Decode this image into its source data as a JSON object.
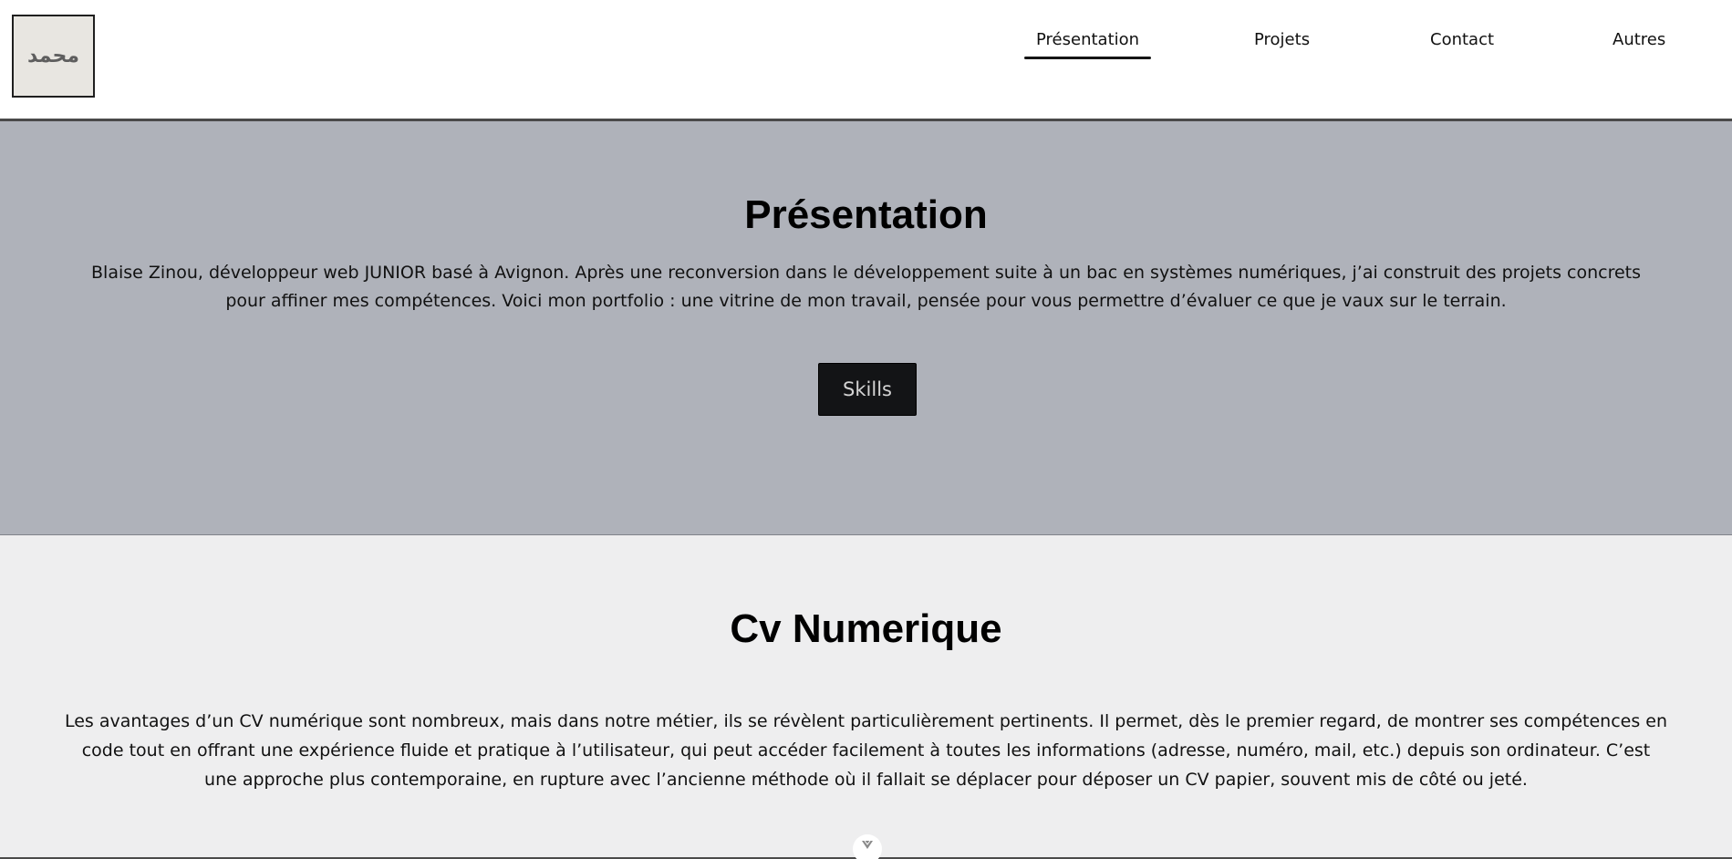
{
  "header": {
    "logo_text": "محمد",
    "nav": [
      {
        "label": "Présentation",
        "active": true
      },
      {
        "label": "Projets",
        "active": false
      },
      {
        "label": "Contact",
        "active": false
      },
      {
        "label": "Autres",
        "active": false
      }
    ]
  },
  "presentation": {
    "title": "Présentation",
    "text": "Blaise Zinou, développeur web JUNIOR basé à Avignon. Après une reconversion dans le développement suite à un bac en systèmes numériques, j’ai construit des projets concrets pour affiner mes compétences. Voici mon portfolio : une vitrine de mon travail, pensée pour vous permettre d’évaluer ce que je vaux sur le terrain.",
    "button_label": "Skills"
  },
  "cv": {
    "title": "Cv Numerique",
    "text": "Les avantages d’un CV numérique sont nombreux, mais dans notre métier, ils se révèlent particulièrement pertinents. Il permet, dès le premier regard, de montrer ses compétences en code tout en offrant une expérience fluide et pratique à l’utilisateur, qui peut accéder facilement à toutes les informations (adresse, numéro, mail, etc.) depuis son ordinateur. C’est une approche plus contemporaine, en rupture avec l’ancienne méthode où il fallait se déplacer pour déposer un CV papier, souvent mis de côté ou jeté.",
    "scroll_icon": "chevron-down-icon"
  },
  "colors": {
    "hero_bg": "#afb2ba",
    "cv_bg": "#eeeeef",
    "button_bg": "#131416",
    "logo_bg": "#e8e6e1"
  }
}
